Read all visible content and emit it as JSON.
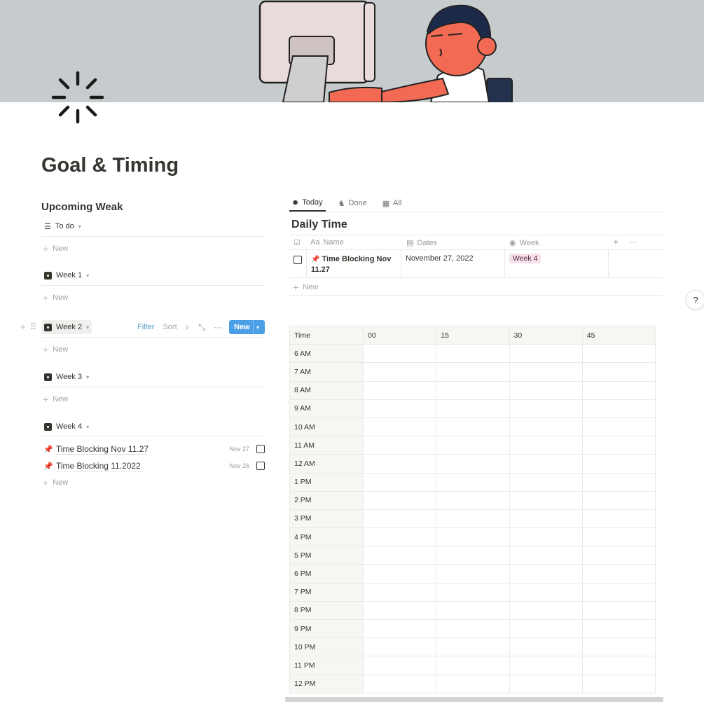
{
  "page": {
    "title": "Goal & Timing"
  },
  "left": {
    "heading": "Upcoming Weak",
    "views": [
      {
        "label": "To do",
        "icon": "list-icon"
      },
      {
        "label": "Week 1",
        "icon": "dice-icon"
      },
      {
        "label": "Week 2",
        "icon": "dice-icon"
      },
      {
        "label": "Week 3",
        "icon": "dice-icon"
      },
      {
        "label": "Week 4",
        "icon": "dice-icon"
      }
    ],
    "new_label": "New",
    "toolbar": {
      "filter": "Filter",
      "sort": "Sort",
      "new_button": "New"
    },
    "tasks": [
      {
        "name": "Time Blocking Nov 11.27",
        "date": "Nov 27",
        "done": false
      },
      {
        "name": "Time Blocking 11.2022",
        "date": "Nov 26",
        "done": false
      }
    ]
  },
  "right": {
    "tabs": [
      {
        "label": "Today",
        "icon": "sun-icon",
        "active": true
      },
      {
        "label": "Done",
        "icon": "horse-icon",
        "active": false
      },
      {
        "label": "All",
        "icon": "table-icon",
        "active": false
      }
    ],
    "db_title": "Daily Time",
    "columns": [
      {
        "label": "Name",
        "icon": "text-icon",
        "prefix": "Aa"
      },
      {
        "label": "Dates",
        "icon": "calendar-icon"
      },
      {
        "label": "Week",
        "icon": "select-icon"
      }
    ],
    "rows": [
      {
        "name_line1": "Time Blocking Nov",
        "name_line2": "11.27",
        "date": "November 27, 2022",
        "week": "Week 4"
      }
    ],
    "new_label": "New",
    "time_grid": {
      "header": [
        "Time",
        "00",
        "15",
        "30",
        "45"
      ],
      "hours": [
        "6 AM",
        "7 AM",
        "8 AM",
        "9 AM",
        "10 AM",
        "11 AM",
        "12 AM",
        "1 PM",
        "2 PM",
        "3 PM",
        "4 PM",
        "5 PM",
        "6 PM",
        "7 PM",
        "8 PM",
        "9 PM",
        "10 PM",
        "11 PM",
        "12 PM"
      ]
    }
  },
  "help": "?",
  "colors": {
    "accent": "#4a9fe6",
    "tag_bg": "#f5e0e9",
    "cover_bg": "#c6ccce",
    "person_skin": "#f26a53"
  }
}
